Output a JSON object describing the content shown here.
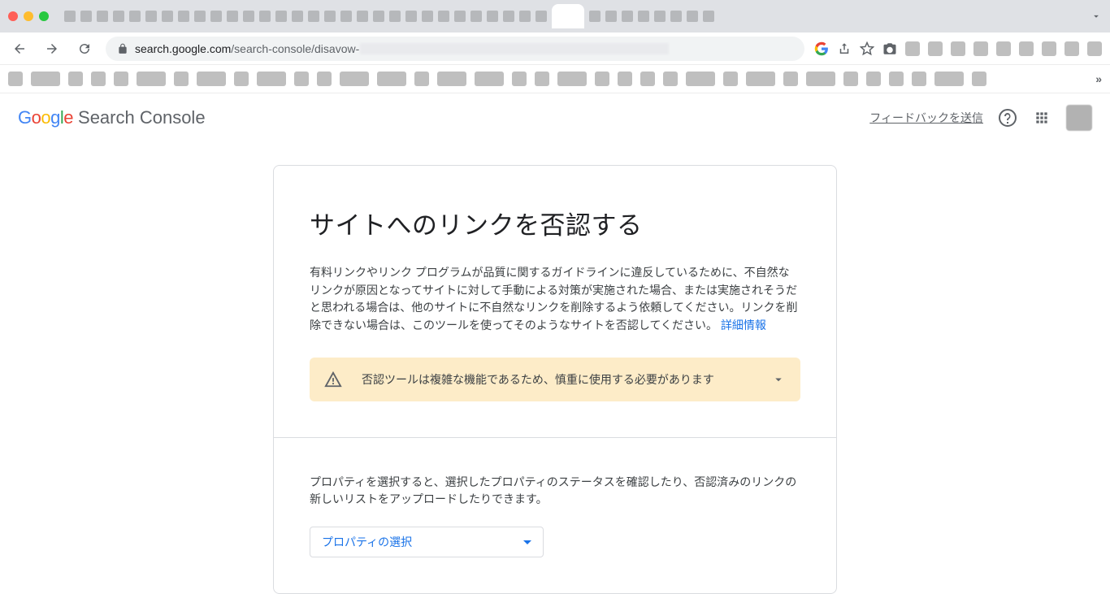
{
  "browser": {
    "host": "search.google.com",
    "path": "/search-console/disavow-"
  },
  "header": {
    "product": "Search Console",
    "feedback": "フィードバックを送信"
  },
  "main": {
    "title": "サイトへのリンクを否認する",
    "description": "有料リンクやリンク プログラムが品質に関するガイドラインに違反しているために、不自然なリンクが原因となってサイトに対して手動による対策が実施された場合、または実施されそうだと思われる場合は、他のサイトに不自然なリンクを削除するよう依頼してください。リンクを削除できない場合は、このツールを使ってそのようなサイトを否認してください。",
    "learn_more": "詳細情報",
    "warning": "否認ツールは複雑な機能であるため、慎重に使用する必要があります",
    "sub_description": "プロパティを選択すると、選択したプロパティのステータスを確認したり、否認済みのリンクの新しいリストをアップロードしたりできます。",
    "property_select": "プロパティの選択"
  }
}
